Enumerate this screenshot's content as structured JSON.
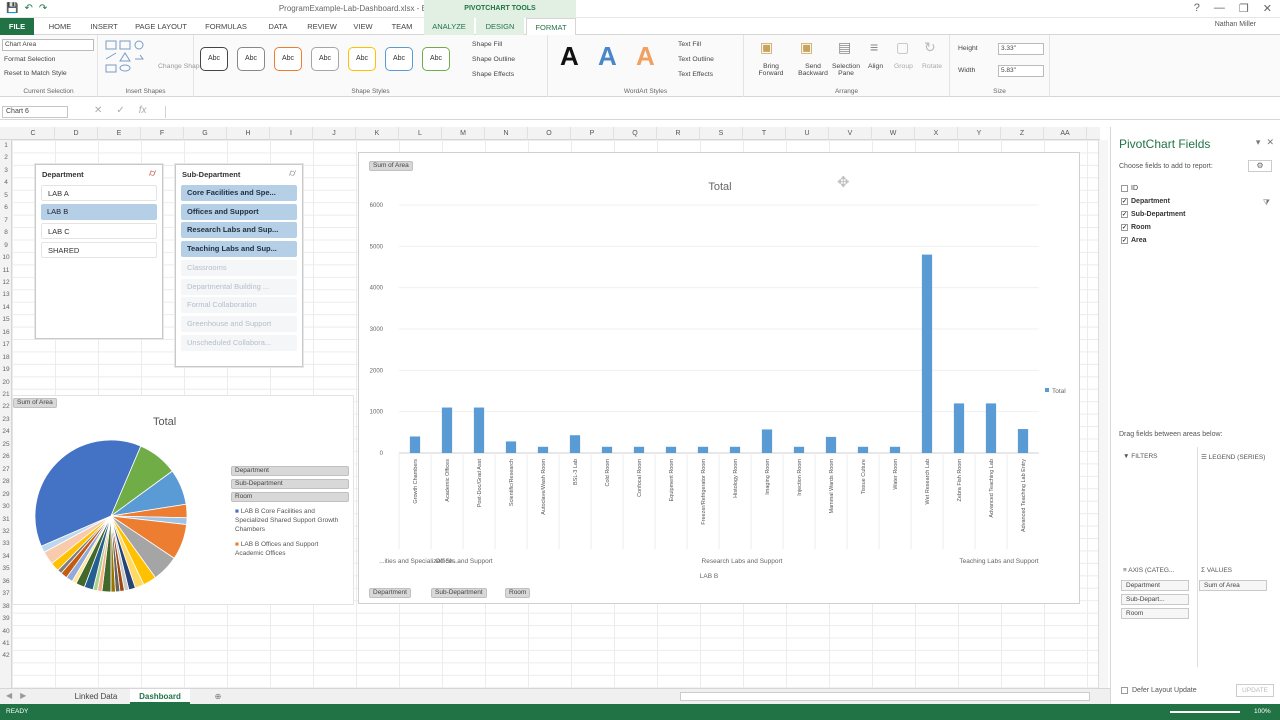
{
  "titlebar": {
    "title": "ProgramExample-Lab-Dashboard.xlsx - Excel",
    "context_tools": "PIVOTCHART TOOLS"
  },
  "tabs": [
    "FILE",
    "HOME",
    "INSERT",
    "PAGE LAYOUT",
    "FORMULAS",
    "DATA",
    "REVIEW",
    "VIEW",
    "TEAM",
    "ANALYZE",
    "DESIGN",
    "FORMAT"
  ],
  "user": "Nathan Miller",
  "ribbon": {
    "chart_element": "Chart Area",
    "format_selection": "Format Selection",
    "reset_style": "Reset to Match Style",
    "current_selection": "Current Selection",
    "insert_shapes": "Insert Shapes",
    "change_shape": "Change Shape",
    "style_abc": "Abc",
    "shape_styles": "Shape Styles",
    "shape_fill": "Shape Fill",
    "shape_outline": "Shape Outline",
    "shape_effects": "Shape Effects",
    "wordart_a": "A",
    "text_fill": "Text Fill",
    "text_outline": "Text Outline",
    "text_effects": "Text Effects",
    "wordart_styles": "WordArt Styles",
    "bring_forward": "Bring Forward",
    "send_backward": "Send Backward",
    "selection_pane": "Selection Pane",
    "align": "Align",
    "group": "Group",
    "rotate": "Rotate",
    "arrange": "Arrange",
    "height_label": "Height",
    "height_value": "3.33\"",
    "width_label": "Width",
    "width_value": "5.83\"",
    "size": "Size"
  },
  "namebox": "Chart 6",
  "columns": [
    "C",
    "D",
    "E",
    "F",
    "G",
    "H",
    "I",
    "J",
    "K",
    "L",
    "M",
    "N",
    "O",
    "P",
    "Q",
    "R",
    "S",
    "T",
    "U",
    "V",
    "W",
    "X",
    "Y",
    "Z",
    "AA"
  ],
  "rows": [
    "1",
    "2",
    "3",
    "4",
    "5",
    "6",
    "7",
    "8",
    "9",
    "10",
    "11",
    "12",
    "13",
    "14",
    "15",
    "16",
    "17",
    "18",
    "19",
    "20",
    "21",
    "22",
    "23",
    "24",
    "25",
    "26",
    "27",
    "28",
    "29",
    "30",
    "31",
    "32",
    "33",
    "34",
    "35",
    "36",
    "37",
    "38",
    "39",
    "40",
    "41",
    "42"
  ],
  "slicer_department": {
    "title": "Department",
    "items": [
      {
        "label": "LAB A",
        "state": "unsel"
      },
      {
        "label": "LAB B",
        "state": "sel"
      },
      {
        "label": "LAB C",
        "state": "unsel"
      },
      {
        "label": "SHARED",
        "state": "unsel"
      }
    ]
  },
  "slicer_subdepartment": {
    "title": "Sub-Department",
    "items": [
      {
        "label": "Core Facilities and Spe...",
        "state": "seldk"
      },
      {
        "label": "Offices and Support",
        "state": "seldk"
      },
      {
        "label": "Research Labs and Sup...",
        "state": "seldk"
      },
      {
        "label": "Teaching Labs and Sup...",
        "state": "seldk"
      },
      {
        "label": "Classrooms",
        "state": "nodata"
      },
      {
        "label": "Departmental Building ...",
        "state": "nodata"
      },
      {
        "label": "Formal Collaboration",
        "state": "nodata"
      },
      {
        "label": "Greenhouse and Support",
        "state": "nodata"
      },
      {
        "label": "Unscheduled Collabora...",
        "state": "nodata"
      }
    ]
  },
  "pie_chart": {
    "value_button": "Sum of Area",
    "filter_buttons": [
      "Department",
      "Sub-Department",
      "Room"
    ],
    "legend": [
      "LAB B Core Facilities and Specialized Shared Support Growth Chambers",
      "LAB B Offices and Support Academic Offices"
    ]
  },
  "chart_data": [
    {
      "type": "bar",
      "title": "Total",
      "legend": "Total",
      "value_button": "Sum of Area",
      "filter_buttons": [
        "Department",
        "Sub-Department",
        "Room"
      ],
      "categories": [
        "Growth Chambers",
        "Academic Offices",
        "Post-Doc/Grad Asst",
        "Scientific/Research",
        "Autoclave/Wash Room",
        "BSL-3 Lab",
        "Cold Room",
        "Confocal Room",
        "Equipment Room",
        "Freezer/Refrigerator Room",
        "Histology Room",
        "Imaging Room",
        "Injection Room",
        "Mammal Wards Room",
        "Tissue Culture",
        "Water Room",
        "Wet Research Lab",
        "Zebra Fish Room",
        "Advanced Teaching Lab",
        "Advanced Teaching Lab Entry"
      ],
      "values": [
        400,
        1100,
        1100,
        280,
        150,
        430,
        150,
        150,
        150,
        150,
        150,
        570,
        150,
        390,
        150,
        150,
        4800,
        1200,
        1200,
        580
      ],
      "group_labels": [
        "...ities and Specialized Sh...",
        "Offices and Support",
        "Research Labs and Support",
        "Teaching Labs and Support"
      ],
      "outer_label": "LAB B",
      "ylim": [
        0,
        6000
      ],
      "yticks": [
        0,
        1000,
        2000,
        3000,
        4000,
        5000,
        6000
      ],
      "color": "#5b9bd5"
    },
    {
      "type": "pie",
      "title": "Total",
      "values": [
        40,
        9,
        8,
        3,
        1.5,
        8,
        6,
        3,
        2,
        1.5,
        1,
        1,
        1,
        1,
        2,
        1,
        1,
        2,
        2,
        1,
        1.5,
        1.5,
        1,
        2,
        3,
        1.5
      ],
      "colors": [
        "#4472c4",
        "#70ad47",
        "#5b9bd5",
        "#ed7d31",
        "#9dc3e6",
        "#ed7d31",
        "#a5a5a5",
        "#ffc000",
        "#ffd966",
        "#264478",
        "#c9c9c9",
        "#9e480e",
        "#636363",
        "#997300",
        "#43682b",
        "#f4b183",
        "#a9d18e",
        "#255e91",
        "#43682b",
        "#ffe699",
        "#8faadc",
        "#c55a11",
        "#7f7f7f",
        "#ffc000",
        "#f8cbad",
        "#bdd7ee"
      ]
    }
  ],
  "pane": {
    "title": "PivotChart Fields",
    "choose": "Choose fields to add to report:",
    "fields": [
      {
        "label": "ID",
        "checked": false
      },
      {
        "label": "Department",
        "checked": true
      },
      {
        "label": "Sub-Department",
        "checked": true
      },
      {
        "label": "Room",
        "checked": true
      },
      {
        "label": "Area",
        "checked": true
      }
    ],
    "drag_hint": "Drag fields between areas below:",
    "filters": "FILTERS",
    "legend_series": "LEGEND (SERIES)",
    "axis": "AXIS (CATEG...",
    "values": "VALUES",
    "axis_items": [
      "Department",
      "Sub-Depart...",
      "Room"
    ],
    "values_items": [
      "Sum of Area"
    ],
    "defer": "Defer Layout Update",
    "update": "UPDATE"
  },
  "sheets": [
    "Linked Data",
    "Dashboard"
  ],
  "status": {
    "ready": "READY",
    "zoom": "100%"
  },
  "colors": {
    "excel_green": "#217346",
    "bar_blue": "#5b9bd5"
  }
}
